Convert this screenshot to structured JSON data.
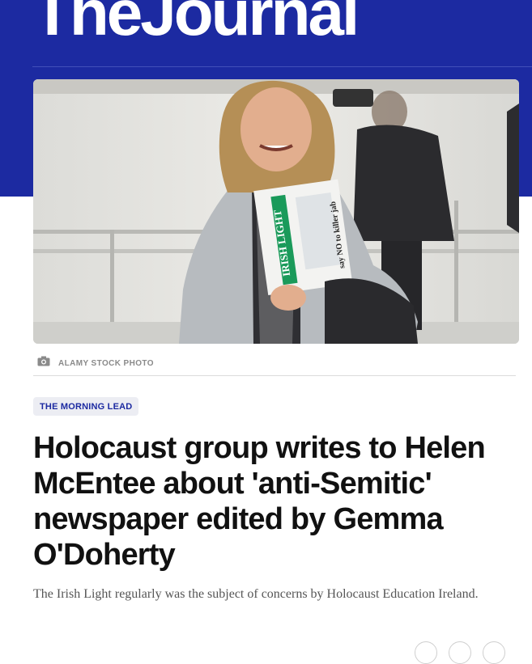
{
  "site": {
    "masthead": "TheJournal"
  },
  "hero": {
    "alt": "Woman in grey coat smiling, carrying newspapers outdoors",
    "photo_credit": "ALAMY STOCK PHOTO",
    "newspaper_masthead": "IRISH LIGHT",
    "newspaper_headline": "say NO to killer jab"
  },
  "article": {
    "section_tag": "THE MORNING LEAD",
    "headline": "Holocaust group writes to Helen McEntee about 'anti-Semitic' newspaper edited by Gemma O'Doherty",
    "standfirst": "The Irish Light regularly was the subject of concerns by Holocaust Education Ireland."
  },
  "share": {
    "icons": [
      "share-icon",
      "share-icon",
      "share-icon"
    ]
  },
  "colors": {
    "brand": "#1c2aa1",
    "tag_bg": "#ecedf3",
    "headline": "#111111",
    "body": "#555555"
  }
}
